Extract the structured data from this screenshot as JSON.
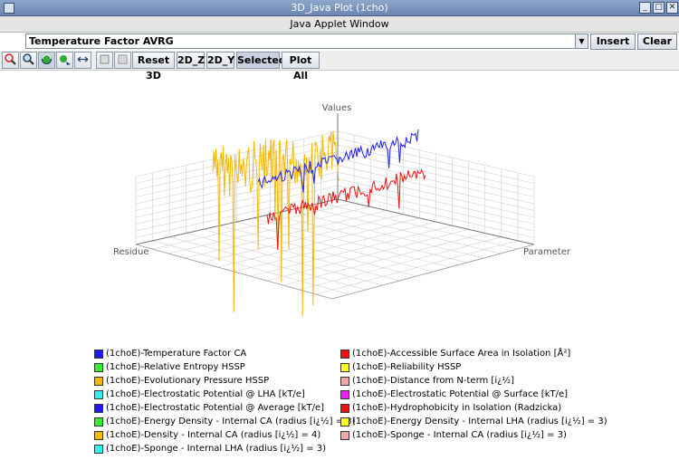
{
  "window": {
    "title": "3D_Java Plot (1cho)",
    "subtitle": "Java Applet Window"
  },
  "window_controls": [
    "minimize",
    "maximize",
    "close"
  ],
  "combo": {
    "selected": "Temperature Factor AVRG"
  },
  "buttons": {
    "insert": "Insert",
    "clear": "Clear"
  },
  "toolbar": {
    "icons": [
      "zoom-in-icon",
      "zoom-out-icon",
      "rotate-icon",
      "translate-icon",
      "scale-icon",
      "blank-box-icon",
      "grid-box-icon"
    ],
    "reset3d": "Reset 3D",
    "view2dz": "2D_Z",
    "view2dy": "2D_Y",
    "selecteds": "Selecteds",
    "plotall": "Plot All"
  },
  "plot": {
    "axis_values": "Values",
    "axis_residue": "Residue",
    "axis_parameter": "Parameter",
    "series_colors": {
      "blue": "#2020ee",
      "orange": "#f5b800",
      "red": "#ee1111"
    }
  },
  "legend": {
    "left": [
      {
        "label": "(1choE)-Temperature Factor CA",
        "color": "#1a1aff"
      },
      {
        "label": "(1choE)-Relative Entropy HSSP",
        "color": "#33ee33"
      },
      {
        "label": "(1choE)-Evolutionary Pressure HSSP",
        "color": "#f5b800"
      },
      {
        "label": "(1choE)-Electrostatic Potential @ LHA [kT/e]",
        "color": "#33eeee"
      },
      {
        "label": "(1choE)-Electrostatic Potential @ Average [kT/e]",
        "color": "#1a1aff"
      },
      {
        "label": "(1choE)-Energy Density - Internal CA (radius [i¿½] = 3)",
        "color": "#33ee33"
      },
      {
        "label": "(1choE)-Density - Internal CA (radius [i¿½] = 4)",
        "color": "#f5b800"
      },
      {
        "label": "(1choE)-Sponge - Internal LHA (radius [i¿½] = 3)",
        "color": "#33eeee"
      }
    ],
    "right": [
      {
        "label": "(1choE)-Accessible Surface Area in Isolation [Å²]",
        "color": "#ee1111"
      },
      {
        "label": "(1choE)-Reliability HSSP",
        "color": "#ffff22"
      },
      {
        "label": "(1choE)-Distance from N-term [i¿½]",
        "color": "#f0a8a8"
      },
      {
        "label": "(1choE)-Electrostatic Potential @ Surface [kT/e]",
        "color": "#ee22ee"
      },
      {
        "label": "(1choE)-Hydrophobicity in Isolation (Radzicka)",
        "color": "#ee1111"
      },
      {
        "label": "(1choE)-Energy Density - Internal LHA (radius [i¿½] = 3)",
        "color": "#ffff22"
      },
      {
        "label": "(1choE)-Sponge - Internal CA (radius [i¿½] = 3)",
        "color": "#f0a8a8"
      }
    ]
  }
}
